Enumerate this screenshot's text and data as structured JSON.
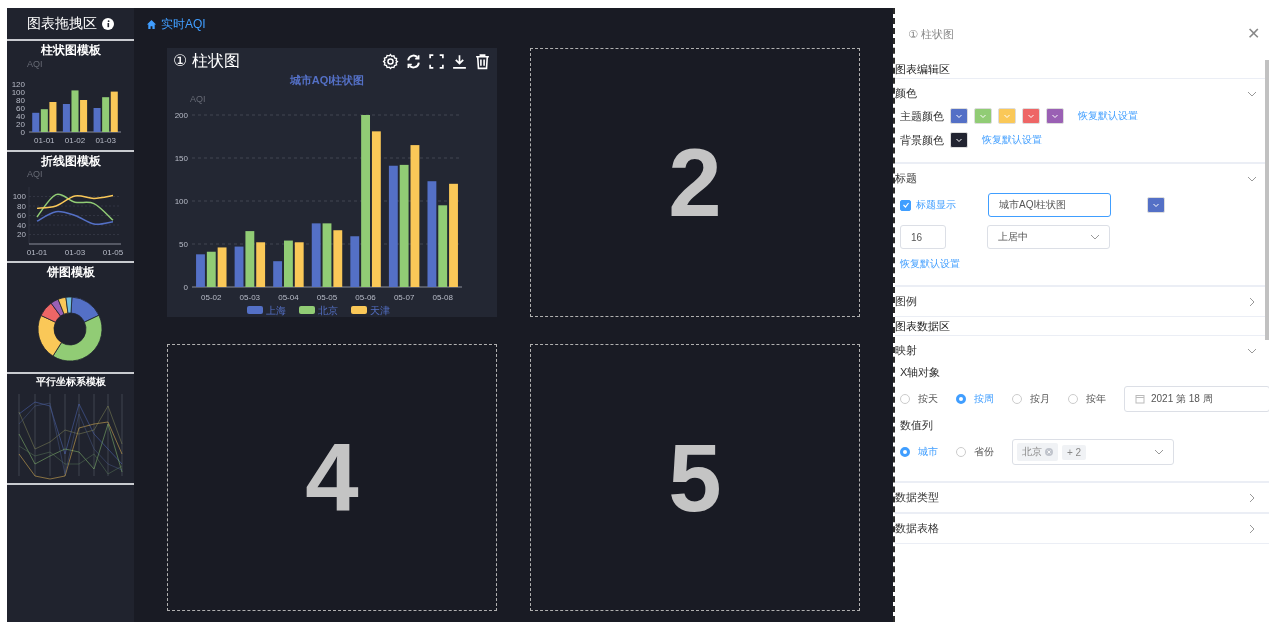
{
  "sidebar": {
    "title": "图表拖拽区",
    "templates": [
      {
        "kind": "bar",
        "title": "柱状图模板",
        "chart_data": {
          "type": "bar",
          "ylabel": "AQI",
          "categories": [
            "01-01",
            "01-02",
            "01-03"
          ],
          "yticks": [
            0,
            20,
            40,
            60,
            80,
            100,
            120
          ],
          "ylim": [
            0,
            120
          ],
          "series": [
            {
              "color": "#5470c6",
              "values": [
                48,
                70,
                60
              ]
            },
            {
              "color": "#91cc75",
              "values": [
                57,
                104,
                87
              ]
            },
            {
              "color": "#fac858",
              "values": [
                75,
                80,
                101
              ]
            }
          ]
        }
      },
      {
        "kind": "line",
        "title": "折线图模板",
        "chart_data": {
          "type": "line",
          "ylabel": "AQI",
          "categories": [
            "01-01",
            null,
            "01-03",
            null,
            "01-05"
          ],
          "yticks": [
            20,
            40,
            60,
            80,
            100
          ],
          "ylim": [
            0,
            120
          ],
          "grid": true,
          "series": [
            {
              "color": "#5470c6",
              "values": [
                48,
                68,
                60,
                42,
                47
              ]
            },
            {
              "color": "#91cc75",
              "values": [
                57,
                104,
                88,
                85,
                50
              ]
            },
            {
              "color": "#fac858",
              "values": [
                75,
                80,
                101,
                96,
                102
              ]
            }
          ]
        }
      },
      {
        "kind": "pie",
        "title": "饼图模板"
      },
      {
        "kind": "parallel",
        "title": "平行坐标系模板"
      }
    ]
  },
  "breadcrumb": "实时AQI",
  "slots": [
    {
      "kind": "chart",
      "index": "①",
      "title": "柱状图",
      "chart_data": {
        "type": "bar",
        "title": "城市AQI柱状图",
        "ylabel": "AQI",
        "categories": [
          "05-02",
          "05-03",
          "05-04",
          "05-05",
          "05-06",
          "05-07",
          "05-08"
        ],
        "yticks": [
          0,
          50,
          100,
          150,
          200
        ],
        "ylim": [
          0,
          200
        ],
        "grid": true,
        "legend": true,
        "series": [
          {
            "name": "上海",
            "color": "#5470c6",
            "values": [
              38,
              47,
              30,
              74,
              59,
              141,
              123
            ]
          },
          {
            "name": "北京",
            "color": "#91cc75",
            "values": [
              41,
              65,
              54,
              74,
              200,
              142,
              95
            ]
          },
          {
            "name": "天津",
            "color": "#fac858",
            "values": [
              46,
              52,
              52,
              66,
              181,
              165,
              120
            ]
          }
        ]
      }
    },
    {
      "kind": "empty",
      "number": "2"
    },
    {
      "kind": "empty",
      "number": "4"
    },
    {
      "kind": "empty",
      "number": "5"
    }
  ],
  "panel": {
    "index": "①",
    "title": "柱状图",
    "close": "✕",
    "edit_section": "图表编辑区",
    "edit_groups": [
      {
        "kind": "color",
        "title": "颜色",
        "expanded": true,
        "theme_label": "主题颜色",
        "theme_colors": [
          {
            "color": "#5470c6"
          },
          {
            "color": "#91cc75"
          },
          {
            "color": "#fac858"
          },
          {
            "color": "#ee6666"
          },
          {
            "color": "#9a60b4"
          }
        ],
        "theme_reset": "恢复默认设置",
        "bg_label": "背景颜色",
        "background": {
          "color": "#222431"
        },
        "bg_reset": "恢复默认设置"
      },
      {
        "kind": "title",
        "title": "标题",
        "expanded": true,
        "show_label": "标题显示",
        "checked": true,
        "title_value": "城市AQI柱状图",
        "title_color": {
          "color": "#5470c6"
        },
        "font_size": "16",
        "position": "上居中",
        "reset": "恢复默认设置"
      },
      {
        "kind": "legend",
        "title": "图例",
        "expanded": false
      }
    ],
    "data_section": "图表数据区",
    "data_groups": [
      {
        "kind": "mapping",
        "title": "映射",
        "expanded": true,
        "x_label": "X轴对象",
        "x_options": [
          {
            "label": "按天",
            "selected": false
          },
          {
            "label": "按周",
            "selected": true
          },
          {
            "label": "按月",
            "selected": false
          },
          {
            "label": "按年",
            "selected": false
          }
        ],
        "week_value": "2021 第 18 周",
        "value_label": "数值列",
        "value_options": [
          {
            "label": "城市",
            "selected": true
          },
          {
            "label": "省份",
            "selected": false
          }
        ],
        "tags": [
          "北京"
        ],
        "more": "+ 2"
      },
      {
        "kind": "types",
        "title": "数据类型",
        "expanded": false
      },
      {
        "kind": "table",
        "title": "数据表格",
        "expanded": false
      }
    ]
  }
}
